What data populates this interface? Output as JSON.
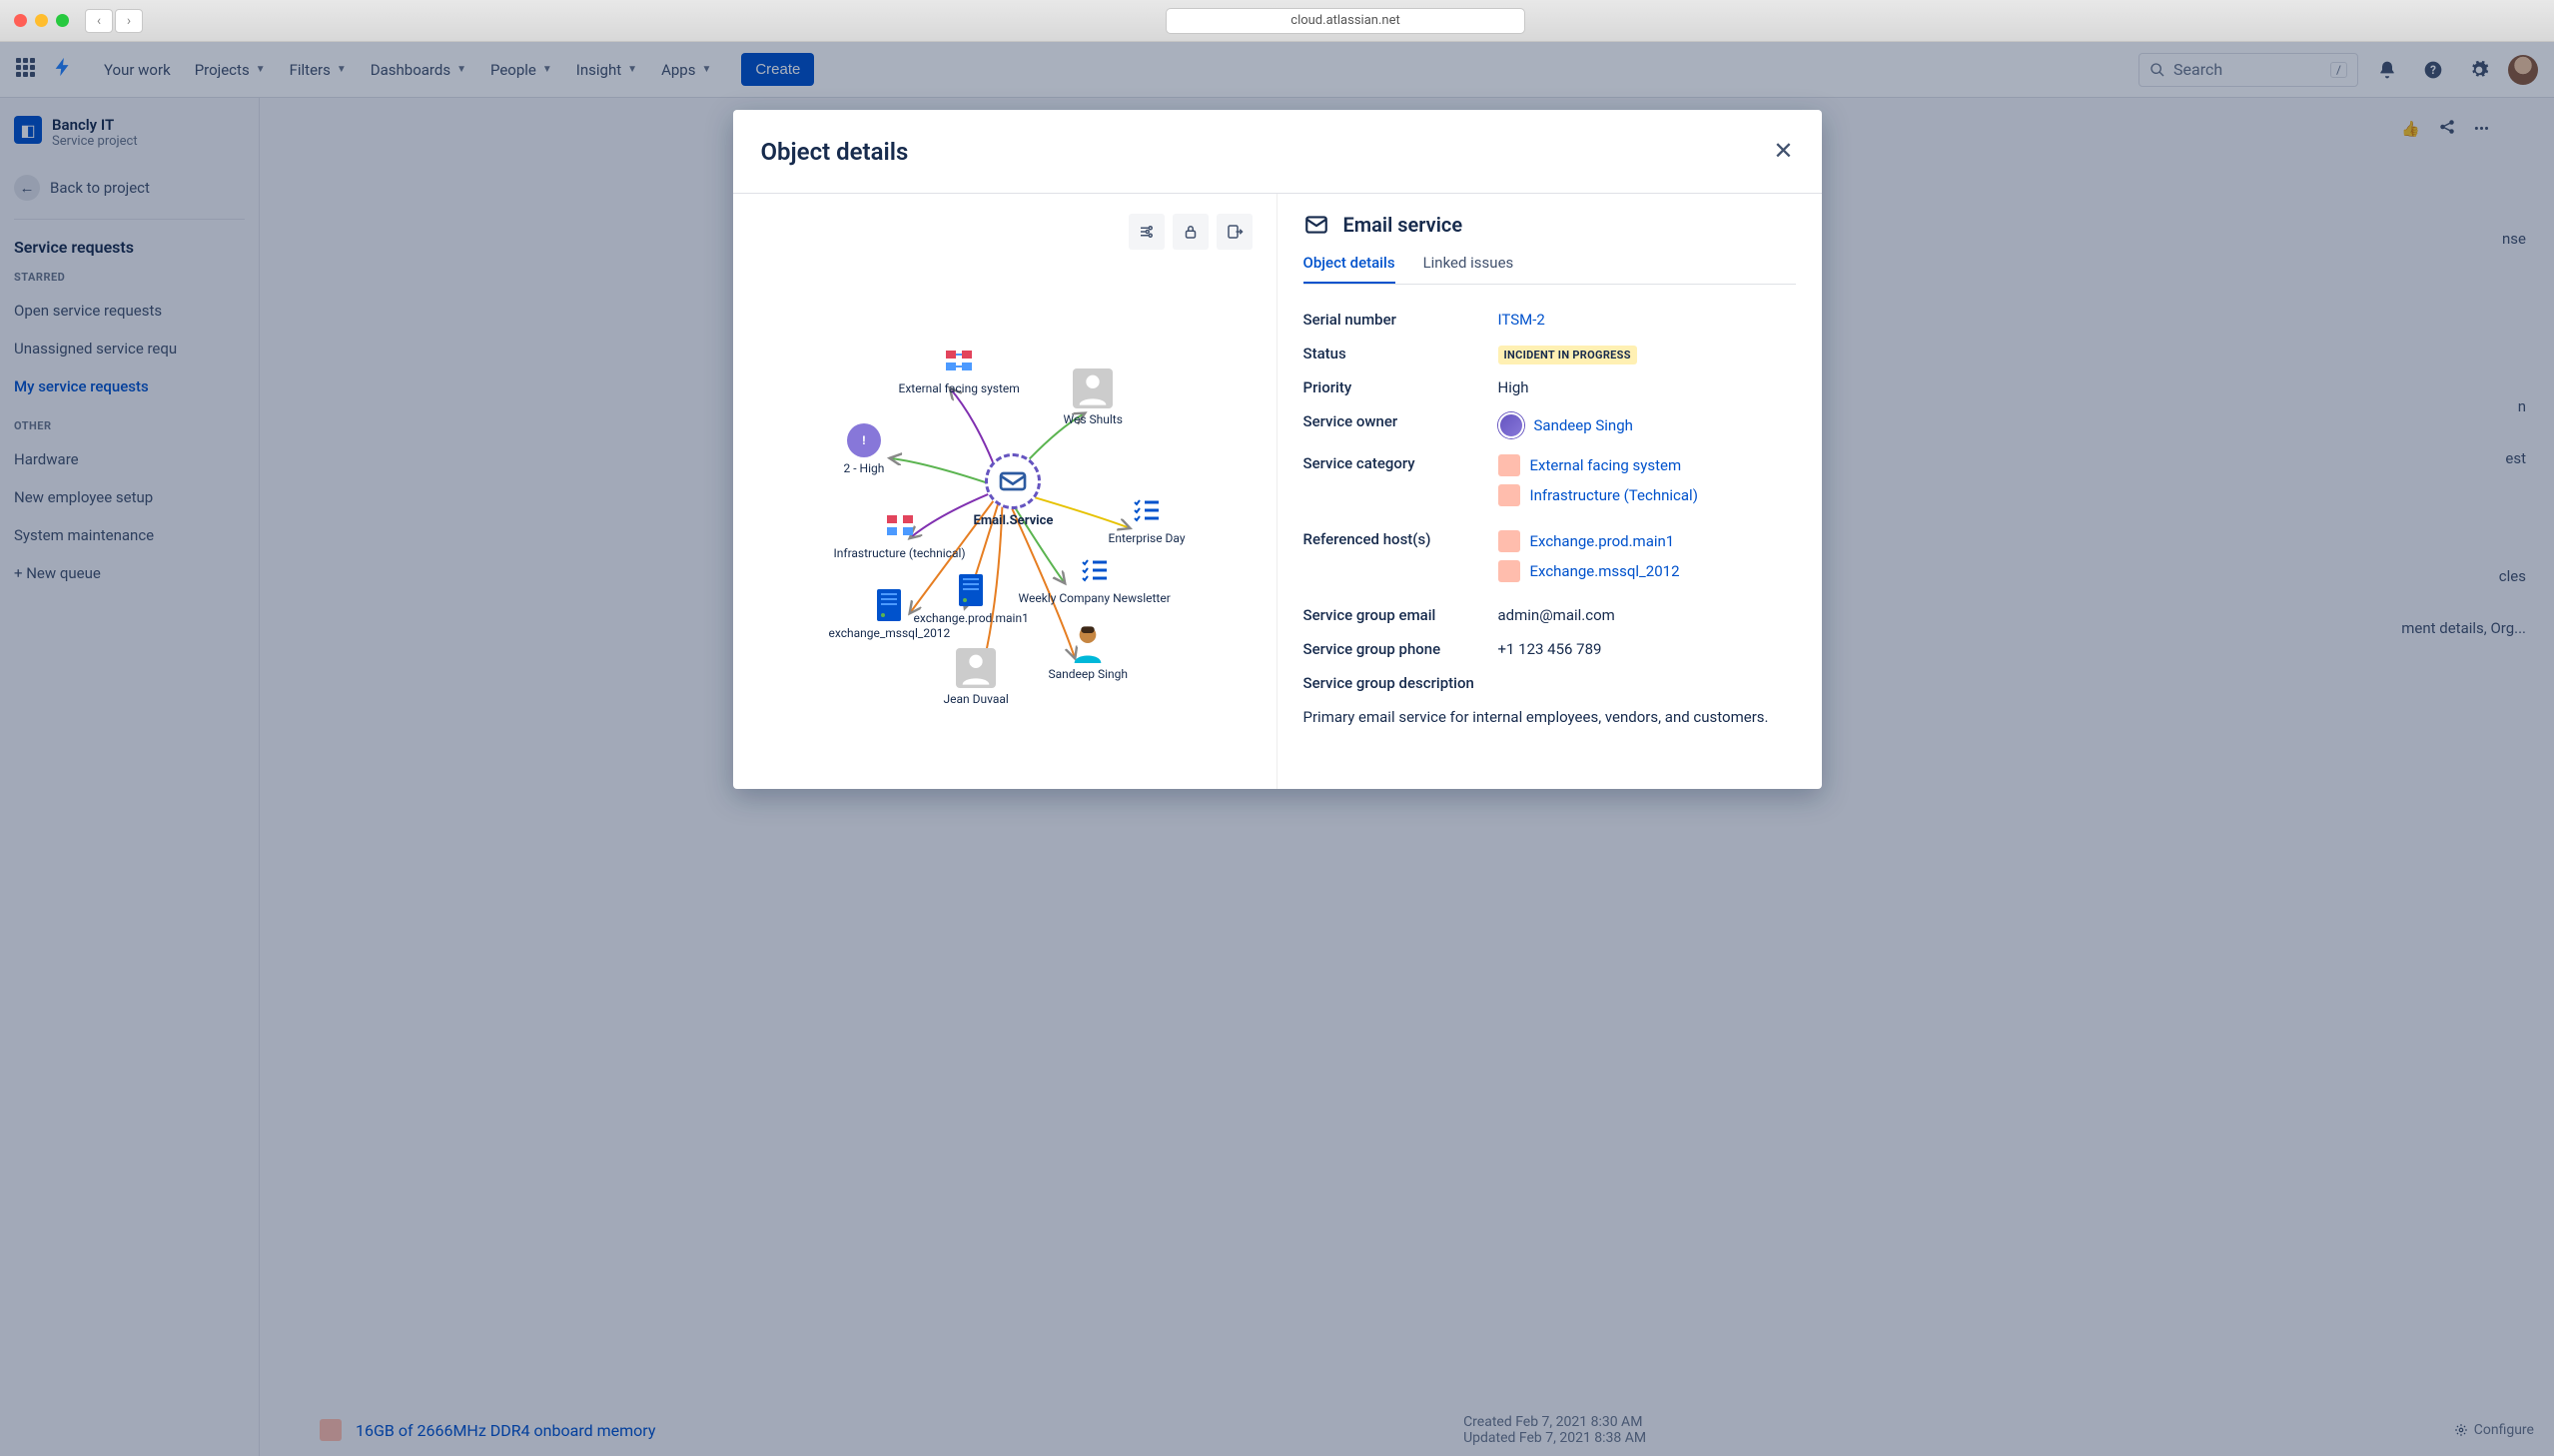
{
  "titlebar": {
    "url": "cloud.atlassian.net"
  },
  "topnav": {
    "items": [
      "Your work",
      "Projects",
      "Filters",
      "Dashboards",
      "People",
      "Insight",
      "Apps"
    ],
    "create": "Create",
    "search_placeholder": "Search",
    "search_shortcut": "/"
  },
  "sidebar": {
    "project_name": "Bancly IT",
    "project_type": "Service project",
    "back": "Back to project",
    "heading": "Service requests",
    "starred_label": "STARRED",
    "starred": [
      "Open service requests",
      "Unassigned service requ",
      "My service requests"
    ],
    "starred_active": 2,
    "other_label": "OTHER",
    "other": [
      "Hardware",
      "New employee setup",
      "System maintenance"
    ],
    "new_queue": "+ New queue"
  },
  "bg": {
    "r1": "nse",
    "r2": "n",
    "r3": "est",
    "r4": "cles",
    "r5": "ment details, Org...",
    "created": "Created Feb 7, 2021 8:30 AM",
    "updated": "Updated Feb 7, 2021 8:38 AM",
    "configure": "Configure",
    "memory": "16GB of 2666MHz DDR4 onboard memory"
  },
  "modal": {
    "title": "Object details",
    "object_name": "Email service",
    "tabs": [
      "Object details",
      "Linked issues"
    ],
    "active_tab": 0,
    "fields": {
      "serial_label": "Serial number",
      "serial_value": "ITSM-2",
      "status_label": "Status",
      "status_value": "INCIDENT IN PROGRESS",
      "priority_label": "Priority",
      "priority_value": "High",
      "owner_label": "Service owner",
      "owner_value": "Sandeep Singh",
      "category_label": "Service category",
      "category_values": [
        "External facing system",
        "Infrastructure (Technical)"
      ],
      "hosts_label": "Referenced host(s)",
      "hosts_values": [
        "Exchange.prod.main1",
        "Exchange.mssql_2012"
      ],
      "email_label": "Service group email",
      "email_value": "admin@mail.com",
      "phone_label": "Service group phone",
      "phone_value": "+1 123 456 789",
      "desc_label": "Service group description",
      "desc_value": "Primary email service for internal employees, vendors, and customers."
    },
    "graph": {
      "center": "Email.Service",
      "nodes": [
        {
          "label": "External facing system"
        },
        {
          "label": "Wes Shults"
        },
        {
          "label": "2 - High"
        },
        {
          "label": "Infrastructure (technical)"
        },
        {
          "label": "Enterprise Day"
        },
        {
          "label": "Weekly Company Newsletter"
        },
        {
          "label": "exchange.prod.main1"
        },
        {
          "label": "exchange_mssql_2012"
        },
        {
          "label": "Jean Duvaal"
        },
        {
          "label": "Sandeep Singh"
        }
      ]
    }
  }
}
